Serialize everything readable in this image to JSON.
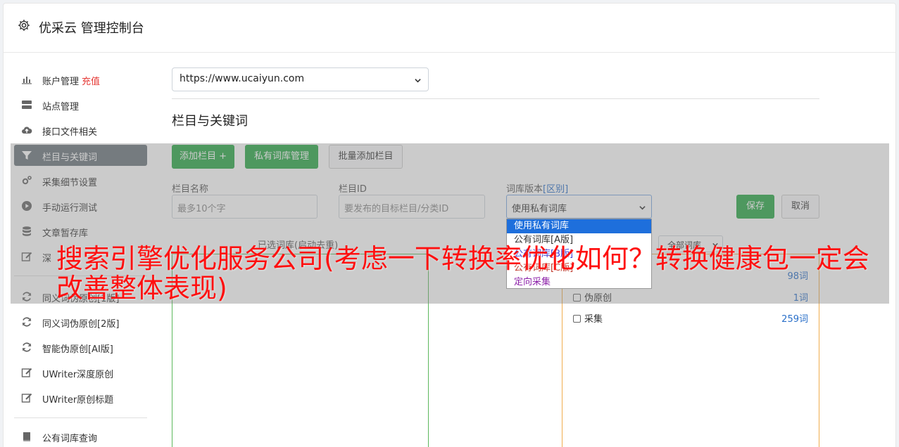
{
  "app": {
    "title": "优采云 管理控制台"
  },
  "sidebar": {
    "items": [
      {
        "label": "账户管理",
        "extra": "充值",
        "icon": "bar-chart-icon"
      },
      {
        "label": "站点管理",
        "icon": "server-icon"
      },
      {
        "label": "接口文件相关",
        "icon": "cloud-upload-icon"
      },
      {
        "label": "栏目与关键词",
        "icon": "filter-icon",
        "active": true
      },
      {
        "label": "采集细节设置",
        "icon": "cogs-icon"
      },
      {
        "label": "手动运行测试",
        "icon": "play-circle-icon"
      },
      {
        "label": "文章暂存库",
        "icon": "database-icon"
      },
      {
        "label": "深",
        "icon": "edit-icon"
      },
      {
        "label": "同义词伪原创[1版]",
        "icon": "refresh-icon"
      },
      {
        "label": "同义词伪原创[2版]",
        "icon": "refresh-icon"
      },
      {
        "label": "智能伪原创[AI版]",
        "icon": "refresh-icon"
      },
      {
        "label": "UWriter深度原创",
        "icon": "edit-icon"
      },
      {
        "label": "UWriter原创标题",
        "icon": "edit-icon"
      },
      {
        "label": "公有词库查询",
        "icon": "book-icon"
      }
    ]
  },
  "main": {
    "site_select_value": "https://www.ucaiyun.com",
    "section_title": "栏目与关键词",
    "buttons": {
      "add_column": "添加栏目 +",
      "private_lib": "私有词库管理",
      "batch_add": "批量添加栏目"
    },
    "form": {
      "name_label": "栏目名称",
      "name_placeholder": "最多10个字",
      "id_label": "栏目ID",
      "id_placeholder": "要发布的目标栏目/分类ID",
      "version_label": "词库版本",
      "version_label_link": "[区别]",
      "version_value": "使用私有词库",
      "save": "保存",
      "cancel": "取消"
    },
    "dropdown_options": [
      {
        "label": "使用私有词库",
        "color": "#ffffff",
        "selected": true
      },
      {
        "label": "公有词库[A版]",
        "color": "#333333"
      },
      {
        "label": "公有词库[B版]",
        "color": "#3b3bd6"
      },
      {
        "label": "公有词库[C版]",
        "color": "#c0392b"
      },
      {
        "label": "定向采集",
        "color": "#8e24aa"
      }
    ],
    "left_panel_caption": "已选词库(启动去重)",
    "all_libs_select": "全部词库",
    "right_list": [
      {
        "label": "",
        "count": "98词"
      },
      {
        "label": "伪原创",
        "count": "1词"
      },
      {
        "label": "采集",
        "count": "259词"
      }
    ]
  },
  "overlay_text": "搜索引擎优化服务公司(考虑一下转换率优化如何？转换健康包一定会改善整体表现)"
}
